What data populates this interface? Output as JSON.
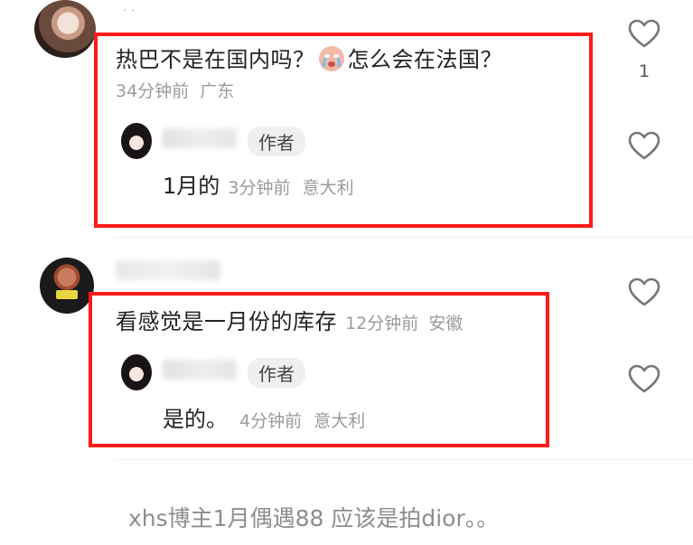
{
  "comments": [
    {
      "username": "·  ·",
      "text_before_emoji": "热巴不是在国内吗？",
      "emoji": "crying-face-emoji",
      "text_after_emoji": "怎么会在法国？",
      "time": "34分钟前",
      "location": "广东",
      "likes": "1",
      "reply": {
        "badge": "作者",
        "text": "1月的",
        "time": "3分钟前",
        "location": "意大利"
      }
    },
    {
      "text": "看感觉是一月份的库存",
      "time": "12分钟前",
      "location": "安徽",
      "reply": {
        "badge": "作者",
        "text": "是的。",
        "time": "4分钟前",
        "location": "意大利"
      }
    }
  ],
  "footer": {
    "text": "xhs博主1月偶遇88 应该是拍dior。。"
  },
  "colors": {
    "highlight_box": "#ff1a1a",
    "meta_text": "#9a9a9a",
    "heart_stroke": "#777777"
  }
}
